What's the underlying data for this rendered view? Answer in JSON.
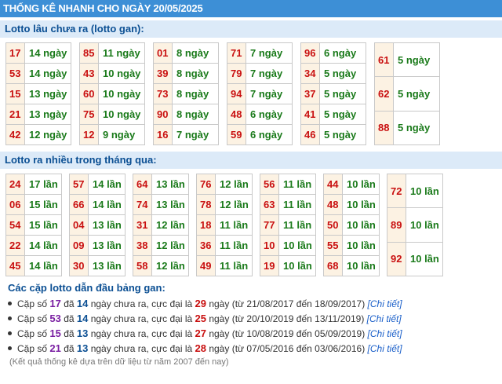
{
  "title": "THỐNG KÊ NHANH CHO NGÀY 20/05/2025",
  "gan": {
    "heading": "Lotto lâu chưa ra (lotto gan):",
    "groups": [
      [
        [
          "17",
          "14 ngày"
        ],
        [
          "53",
          "14 ngày"
        ],
        [
          "15",
          "13 ngày"
        ],
        [
          "21",
          "13 ngày"
        ],
        [
          "42",
          "12 ngày"
        ]
      ],
      [
        [
          "85",
          "11 ngày"
        ],
        [
          "43",
          "10 ngày"
        ],
        [
          "60",
          "10 ngày"
        ],
        [
          "75",
          "10 ngày"
        ],
        [
          "12",
          "9 ngày"
        ]
      ],
      [
        [
          "01",
          "8 ngày"
        ],
        [
          "39",
          "8 ngày"
        ],
        [
          "73",
          "8 ngày"
        ],
        [
          "90",
          "8 ngày"
        ],
        [
          "16",
          "7 ngày"
        ]
      ],
      [
        [
          "71",
          "7 ngày"
        ],
        [
          "79",
          "7 ngày"
        ],
        [
          "94",
          "7 ngày"
        ],
        [
          "48",
          "6 ngày"
        ],
        [
          "59",
          "6 ngày"
        ]
      ],
      [
        [
          "96",
          "6 ngày"
        ],
        [
          "34",
          "5 ngày"
        ],
        [
          "37",
          "5 ngày"
        ],
        [
          "41",
          "5 ngày"
        ],
        [
          "46",
          "5 ngày"
        ]
      ],
      [
        [
          "61",
          "5 ngày"
        ],
        [
          "62",
          "5 ngày"
        ],
        [
          "88",
          "5 ngày"
        ]
      ]
    ]
  },
  "nhieu": {
    "heading": "Lotto ra nhiều trong tháng qua:",
    "groups": [
      [
        [
          "24",
          "17 lần"
        ],
        [
          "06",
          "15 lần"
        ],
        [
          "54",
          "15 lần"
        ],
        [
          "22",
          "14 lần"
        ],
        [
          "45",
          "14 lần"
        ]
      ],
      [
        [
          "57",
          "14 lần"
        ],
        [
          "66",
          "14 lần"
        ],
        [
          "04",
          "13 lần"
        ],
        [
          "09",
          "13 lần"
        ],
        [
          "30",
          "13 lần"
        ]
      ],
      [
        [
          "64",
          "13 lần"
        ],
        [
          "74",
          "13 lần"
        ],
        [
          "31",
          "12 lần"
        ],
        [
          "38",
          "12 lần"
        ],
        [
          "58",
          "12 lần"
        ]
      ],
      [
        [
          "76",
          "12 lần"
        ],
        [
          "78",
          "12 lần"
        ],
        [
          "18",
          "11 lần"
        ],
        [
          "36",
          "11 lần"
        ],
        [
          "49",
          "11 lần"
        ]
      ],
      [
        [
          "56",
          "11 lần"
        ],
        [
          "63",
          "11 lần"
        ],
        [
          "77",
          "11 lần"
        ],
        [
          "10",
          "10 lần"
        ],
        [
          "19",
          "10 lần"
        ]
      ],
      [
        [
          "44",
          "10 lần"
        ],
        [
          "48",
          "10 lần"
        ],
        [
          "50",
          "10 lần"
        ],
        [
          "55",
          "10 lần"
        ],
        [
          "68",
          "10 lần"
        ]
      ],
      [
        [
          "72",
          "10 lần"
        ],
        [
          "89",
          "10 lần"
        ],
        [
          "92",
          "10 lần"
        ]
      ]
    ]
  },
  "leaders": {
    "heading": "Các cặp lotto dẫn đầu bảng gan:",
    "prefix": "Cặp số",
    "da": "đã",
    "chuara": "ngày chưa ra, cực đại là",
    "ngay": "ngày",
    "detail_label": "[Chi tiết]",
    "items": [
      {
        "pair": "17",
        "days": "14",
        "max": "29",
        "range": "(từ 21/08/2017 đến 18/09/2017)"
      },
      {
        "pair": "53",
        "days": "14",
        "max": "25",
        "range": "(từ 20/10/2019 đến 13/11/2019)"
      },
      {
        "pair": "15",
        "days": "13",
        "max": "27",
        "range": "(từ 10/08/2019 đến 05/09/2019)"
      },
      {
        "pair": "21",
        "days": "13",
        "max": "28",
        "range": "(từ 07/05/2016 đến 03/06/2016)"
      }
    ],
    "note": "(Kết quả thống kê dựa trên dữ liệu từ năm 2007 đến nay)"
  }
}
